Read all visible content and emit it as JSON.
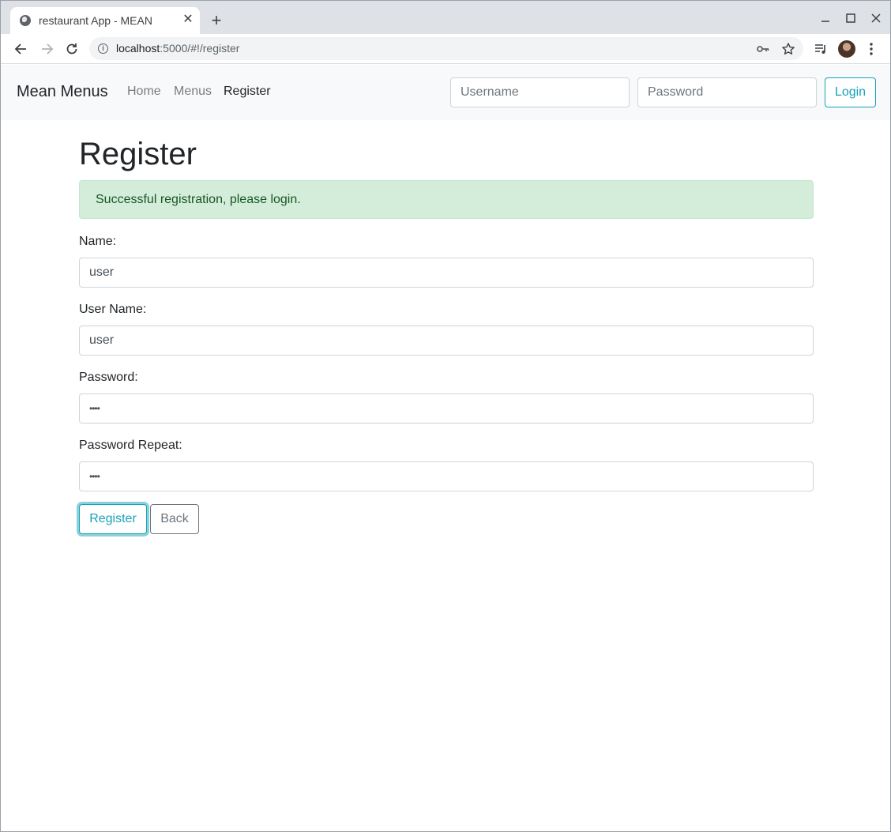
{
  "browser": {
    "tab_title": "restaurant App - MEAN",
    "url_host": "localhost",
    "url_rest": ":5000/#!/register",
    "new_tab_symbol": "+",
    "close_symbol": "✕"
  },
  "navbar": {
    "brand": "Mean Menus",
    "links": [
      {
        "label": "Home",
        "active": false
      },
      {
        "label": "Menus",
        "active": false
      },
      {
        "label": "Register",
        "active": true
      }
    ],
    "login": {
      "username_placeholder": "Username",
      "password_placeholder": "Password",
      "button_label": "Login"
    }
  },
  "page": {
    "title": "Register",
    "alert": "Successful registration, please login.",
    "fields": [
      {
        "label": "Name:",
        "value": "user",
        "type": "text"
      },
      {
        "label": "User Name:",
        "value": "user",
        "type": "text"
      },
      {
        "label": "Password:",
        "value": "••••",
        "type": "password"
      },
      {
        "label": "Password Repeat:",
        "value": "••••",
        "type": "password"
      }
    ],
    "register_button": "Register",
    "back_button": "Back"
  },
  "colors": {
    "accent": "#17a2b8",
    "alert_bg": "#d4edda",
    "alert_text": "#155724",
    "navbar_bg": "#f8f9fa",
    "tabstrip_bg": "#dee1e6"
  },
  "icons": [
    "globe-icon",
    "close-icon",
    "plus-icon",
    "minimize-icon",
    "maximize-icon",
    "back-arrow-icon",
    "forward-arrow-icon",
    "reload-icon",
    "info-icon",
    "key-icon",
    "star-icon",
    "media-queue-icon",
    "avatar",
    "kebab-menu-icon"
  ]
}
